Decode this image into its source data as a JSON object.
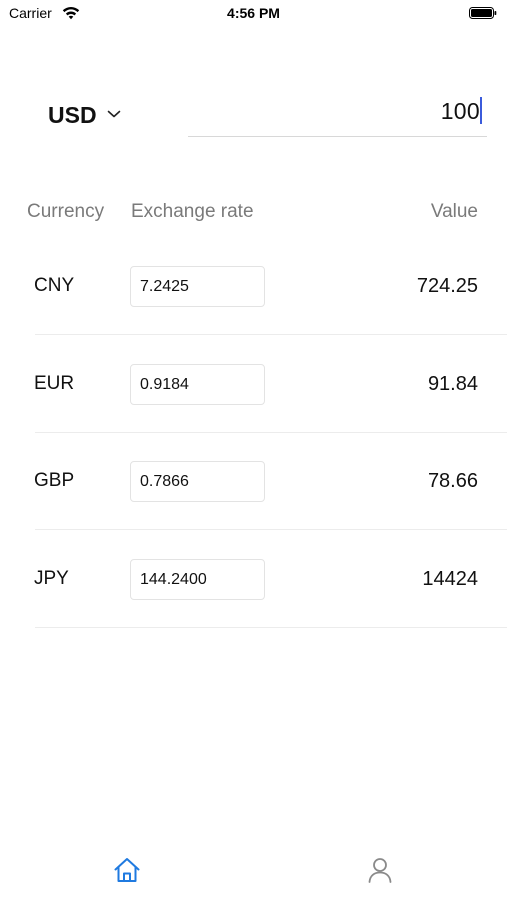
{
  "status_bar": {
    "carrier": "Carrier",
    "time": "4:56 PM"
  },
  "converter": {
    "base_currency": "USD",
    "amount": "100"
  },
  "table": {
    "headers": {
      "currency": "Currency",
      "rate": "Exchange rate",
      "value": "Value"
    },
    "rows": [
      {
        "code": "CNY",
        "rate": "7.2425",
        "value": "724.25"
      },
      {
        "code": "EUR",
        "rate": "0.9184",
        "value": "91.84"
      },
      {
        "code": "GBP",
        "rate": "0.7866",
        "value": "78.66"
      },
      {
        "code": "JPY",
        "rate": "144.2400",
        "value": "14424"
      }
    ]
  },
  "tab_bar": {
    "tabs": [
      {
        "icon": "home-icon",
        "active": true
      },
      {
        "icon": "person-icon",
        "active": false
      }
    ],
    "active_color": "#1f7ae0",
    "inactive_color": "#8a8a8a"
  },
  "colors": {
    "caret": "#3b5bdb",
    "header_text": "#7a7a7a"
  }
}
